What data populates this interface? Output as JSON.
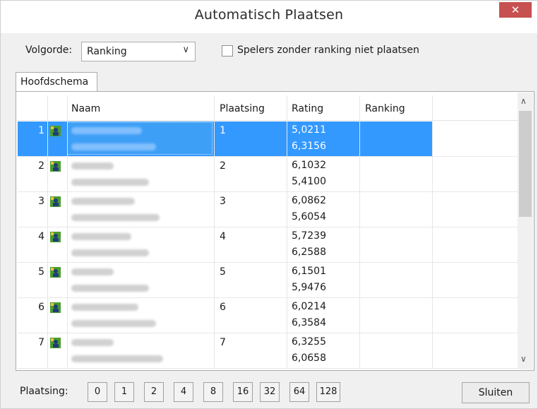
{
  "window": {
    "title": "Automatisch Plaatsen",
    "close_glyph": "✕"
  },
  "volgorde": {
    "label": "Volgorde:",
    "value": "Ranking",
    "chevron": "∨"
  },
  "checkbox": {
    "label": "Spelers zonder ranking niet plaatsen",
    "checked": false
  },
  "tabs": [
    {
      "label": "Hoofdschema",
      "active": true
    }
  ],
  "columns": {
    "naam": "Naam",
    "plaatsing": "Plaatsing",
    "rating": "Rating",
    "ranking": "Ranking"
  },
  "rows": [
    {
      "num": "1",
      "plaatsing": "1",
      "ratings": [
        "5,0211",
        "6,3156"
      ],
      "ranking": "",
      "selected": true
    },
    {
      "num": "2",
      "plaatsing": "2",
      "ratings": [
        "6,1032",
        "5,4100"
      ],
      "ranking": "",
      "selected": false
    },
    {
      "num": "3",
      "plaatsing": "3",
      "ratings": [
        "6,0862",
        "5,6054"
      ],
      "ranking": "",
      "selected": false
    },
    {
      "num": "4",
      "plaatsing": "4",
      "ratings": [
        "5,7239",
        "6,2588"
      ],
      "ranking": "",
      "selected": false
    },
    {
      "num": "5",
      "plaatsing": "5",
      "ratings": [
        "6,1501",
        "5,9476"
      ],
      "ranking": "",
      "selected": false
    },
    {
      "num": "6",
      "plaatsing": "6",
      "ratings": [
        "6,0214",
        "6,3584"
      ],
      "ranking": "",
      "selected": false
    },
    {
      "num": "7",
      "plaatsing": "7",
      "ratings": [
        "6,3255",
        "6,0658"
      ],
      "ranking": "",
      "selected": false
    }
  ],
  "row_icon": "player-pair-icon",
  "scrollbar": {
    "up": "∧",
    "down": "∨"
  },
  "footer": {
    "label": "Plaatsing:",
    "buttons": [
      "0",
      "1",
      "2",
      "4",
      "8",
      "16",
      "32",
      "64",
      "128"
    ],
    "close_label": "Sluiten"
  },
  "colors": {
    "selection": "#3399ff",
    "close": "#c75050"
  }
}
